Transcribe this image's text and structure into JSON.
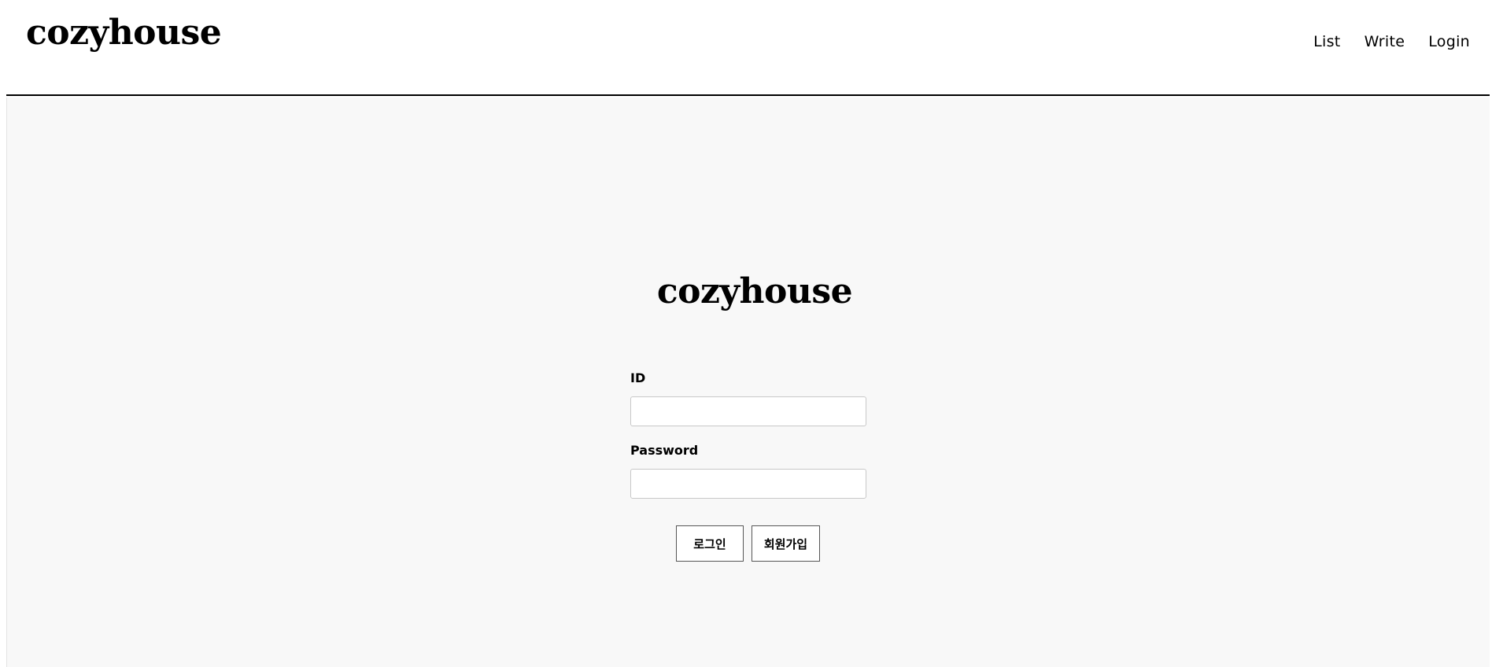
{
  "header": {
    "brand": "cozyhouse",
    "nav": [
      {
        "label": "List"
      },
      {
        "label": "Write"
      },
      {
        "label": "Login"
      }
    ]
  },
  "login_form": {
    "logo": "cozyhouse",
    "id_label": "ID",
    "id_value": "",
    "password_label": "Password",
    "password_value": "",
    "login_button": "로그인",
    "signup_button": "회원가입"
  },
  "colors": {
    "header_background": "#ffffff",
    "main_background": "#f8f8f8",
    "header_divider": "#000000",
    "text": "#000000"
  }
}
